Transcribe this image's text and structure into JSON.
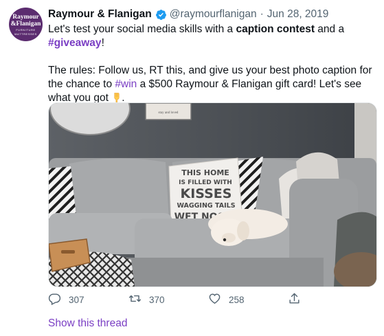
{
  "account": {
    "name": "Raymour & Flanigan",
    "handle": "@raymourflanigan",
    "separator": "·",
    "date": "Jun 28, 2019",
    "avatar_line1": "Raymour",
    "avatar_line2": "&Flanigan",
    "avatar_line3": "FURNITURE",
    "avatar_line4": "MATTRESSES"
  },
  "tweet": {
    "line1_a": "Let's test your social media skills with a ",
    "line1_bold": "caption contest",
    "line1_b": " and a",
    "hashtag1": "#giveaway",
    "line2_end": "!",
    "rules_a": "The rules: Follow us, RT this, and give us your best photo caption for the chance to ",
    "hashtag2": "#win",
    "rules_b": " a $500 Raymour & Flanigan gift card! Let's see what you got ",
    "rules_end": "."
  },
  "pillow_text": [
    "THIS HOME",
    "IS FILLED WITH",
    "KISSES",
    "WAGGING TAILS",
    "WET NOSES"
  ],
  "wall_frame_text": "stay and loved",
  "actions": {
    "replies": "307",
    "retweets": "370",
    "likes": "258"
  },
  "show_thread": "Show this thread",
  "colors": {
    "accent": "#7b3fc4",
    "verified": "#1d9bf0",
    "muted": "#536471",
    "brand": "#5b2c6f"
  },
  "icons": [
    "verified-badge-icon",
    "emoji-pointing-down-icon",
    "reply-icon",
    "retweet-icon",
    "like-icon",
    "share-icon"
  ]
}
